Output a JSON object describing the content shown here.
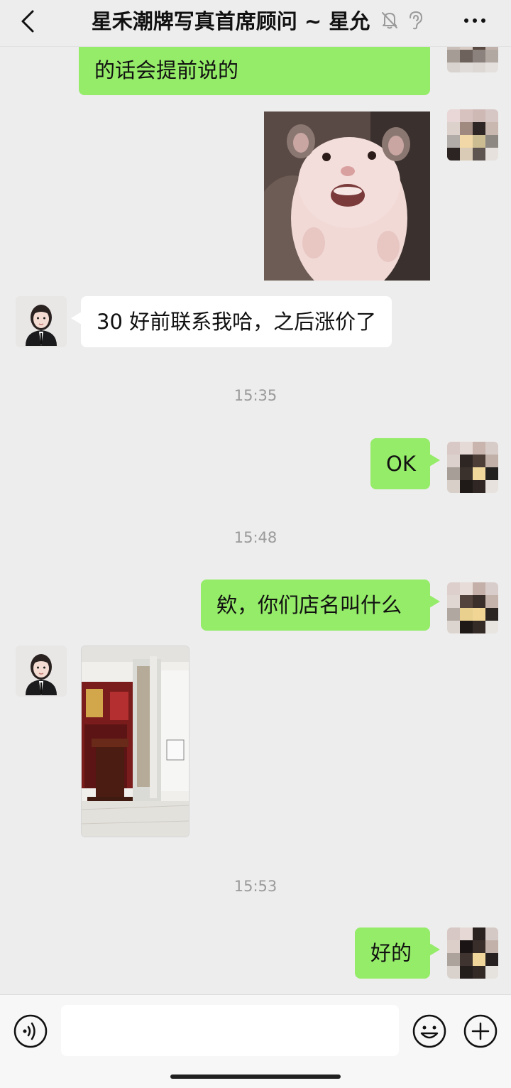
{
  "header": {
    "title": "星禾潮牌写真首席顾问 ~ 星允",
    "icons": [
      "chevron-left-icon",
      "mute-bell-icon",
      "ear-icon",
      "more-dots-icon"
    ]
  },
  "messages": [
    {
      "from": "me",
      "text": "的话会提前说的"
    },
    {
      "from": "me",
      "type": "image",
      "image": "hamster sticker"
    },
    {
      "from": "other",
      "text": "30 好前联系我哈，之后涨价了"
    },
    {
      "type": "time",
      "text": "15:35"
    },
    {
      "from": "me",
      "text": "OK"
    },
    {
      "type": "time",
      "text": "15:48"
    },
    {
      "from": "me",
      "text": "欸，你们店名叫什么"
    },
    {
      "from": "other",
      "type": "image",
      "image": "studio entrance photo"
    },
    {
      "type": "time",
      "text": "15:53"
    },
    {
      "from": "me",
      "text": "好的"
    }
  ],
  "input": {
    "placeholder": ""
  },
  "colors": {
    "background": "#ededed",
    "my_bubble": "#95ec69",
    "other_bubble": "#ffffff",
    "timestamp": "#9a9a9a"
  }
}
